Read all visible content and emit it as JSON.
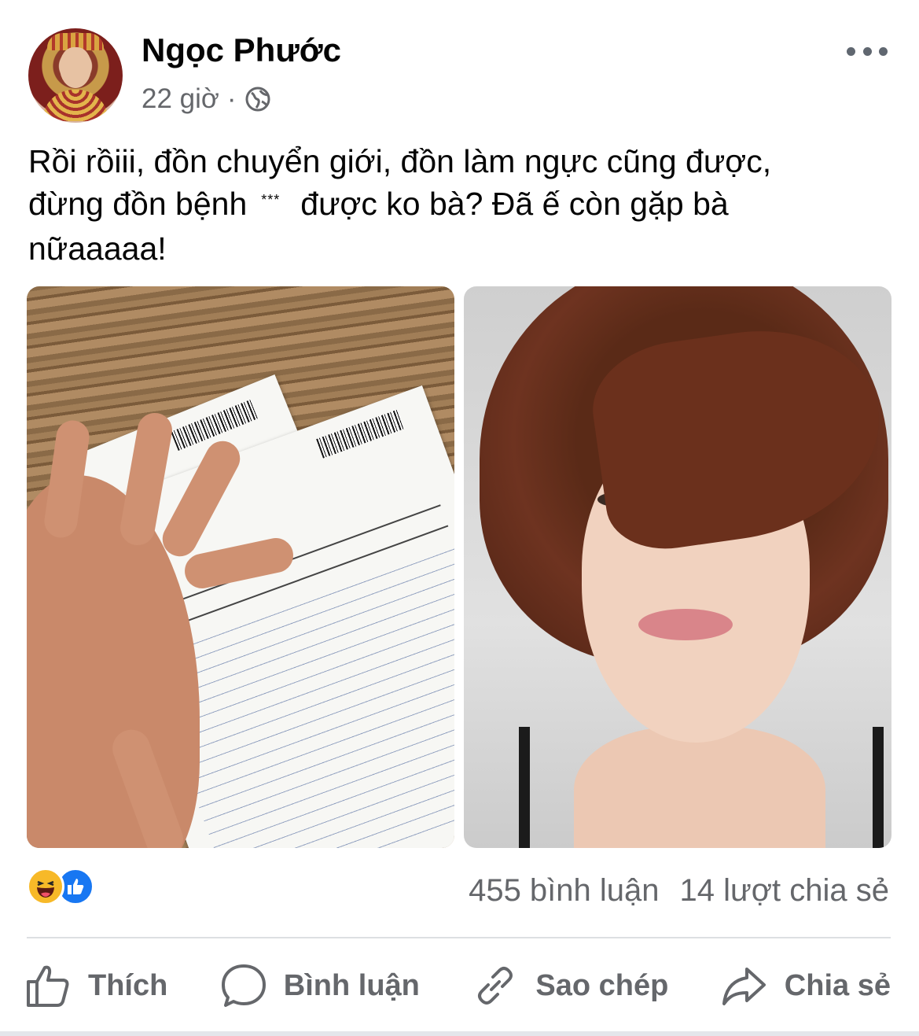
{
  "post": {
    "author": "Ngọc Phước",
    "time": "22 giờ",
    "separator": "·",
    "audience_icon": "globe-icon",
    "menu_icon": "more-horizontal-icon",
    "text_lines": [
      "Rồi rồiii, đồn chuyển giới, đồn làm ngực cũng được,",
      "đừng đồn bệnh",
      "được ko bà? Đã ế còn gặp bà",
      "nữaaaaa!"
    ],
    "censored_mark": "***",
    "photos": [
      {
        "icon": "ultrasound-report-photo"
      },
      {
        "icon": "portrait-photo"
      }
    ]
  },
  "engagement": {
    "reaction_icons": [
      "haha-reaction-icon",
      "like-reaction-icon"
    ],
    "comments": "455 bình luận",
    "shares": "14 lượt chia sẻ"
  },
  "actions": {
    "like": "Thích",
    "comment": "Bình luận",
    "copy": "Sao chép",
    "share": "Chia sẻ"
  },
  "colors": {
    "text": "#050505",
    "secondary": "#65676b",
    "like_blue": "#1877f2",
    "haha_yellow": "#f7b928",
    "divider": "#dddfe2"
  }
}
